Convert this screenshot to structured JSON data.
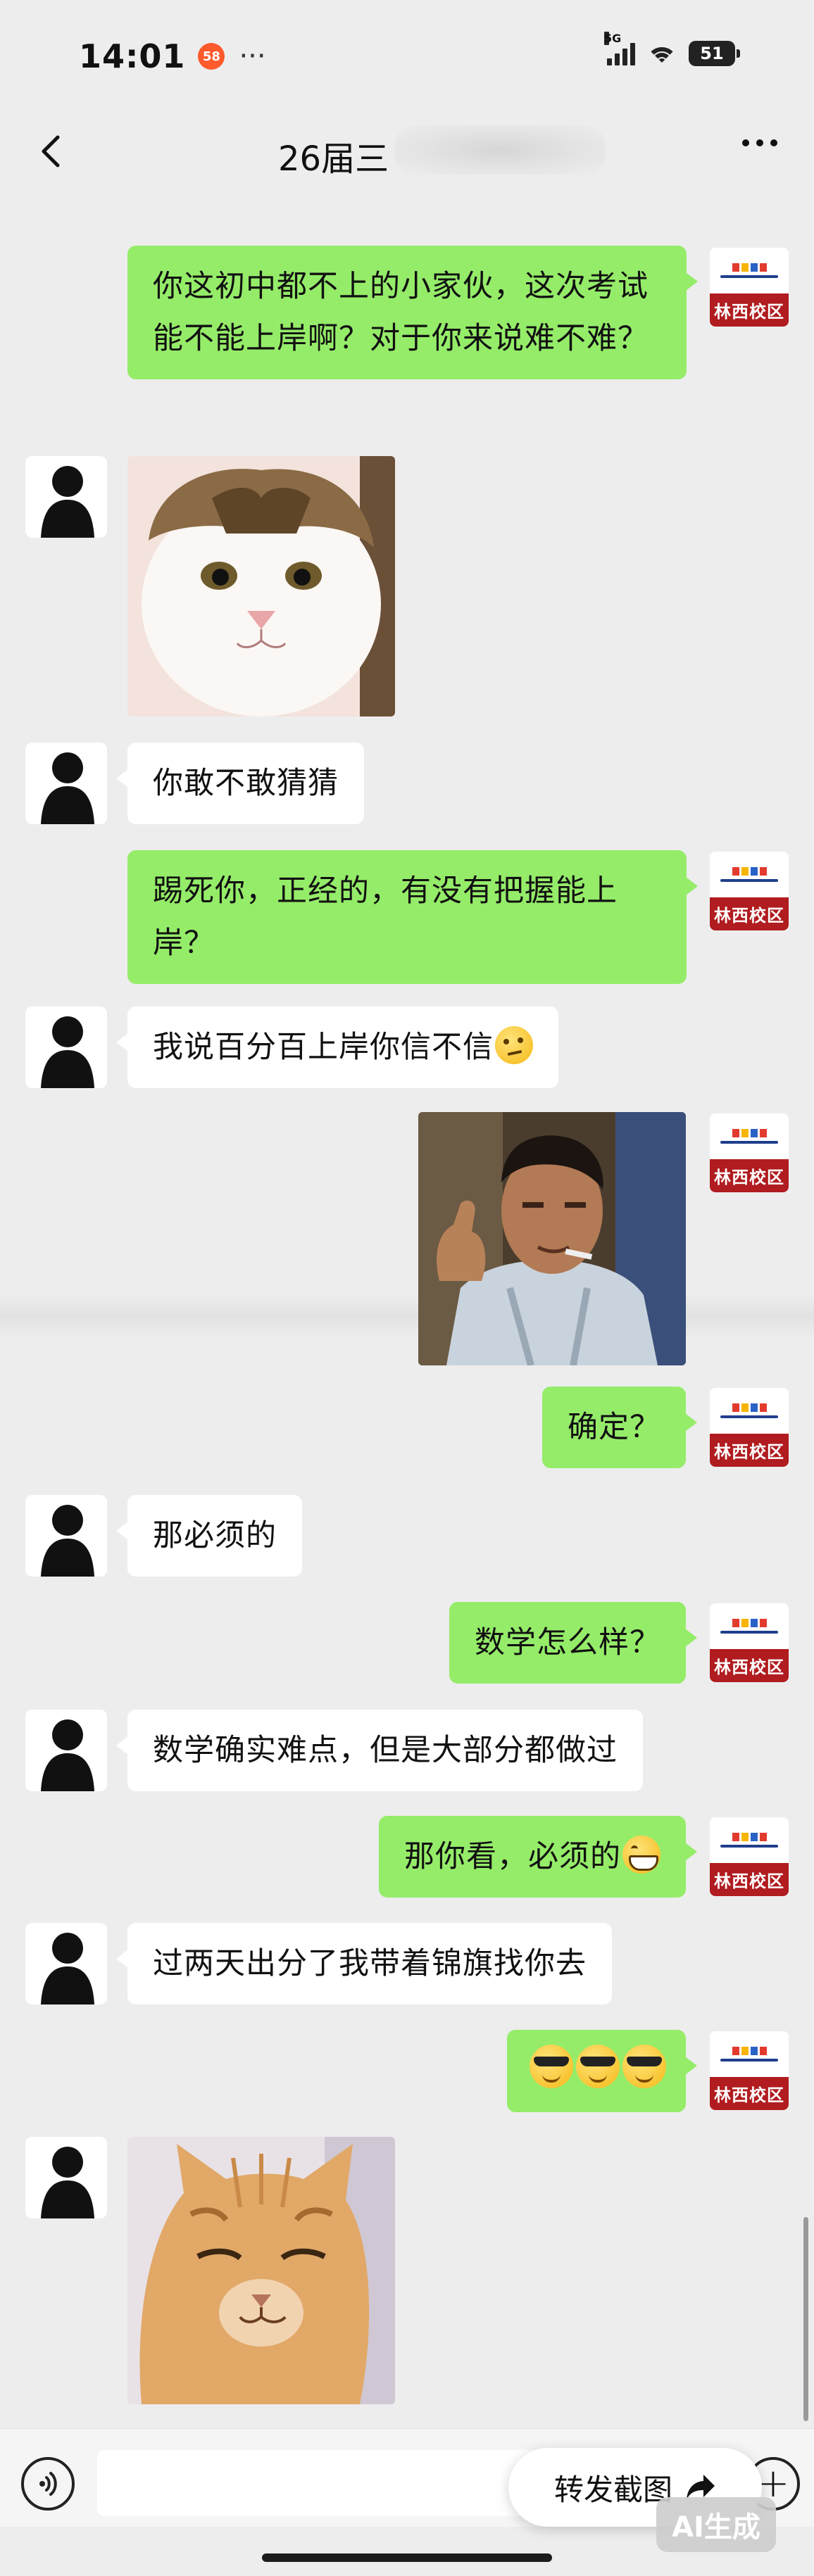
{
  "status_bar": {
    "time": "14:01",
    "badge": "58",
    "network": "5G",
    "battery": "51"
  },
  "header": {
    "title": "26届三"
  },
  "messages": [
    {
      "from": "self",
      "type": "text",
      "text": "你这初中都不上的小家伙，这次考试能不能上岸啊？对于你来说难不难？"
    },
    {
      "from": "other",
      "type": "sticker",
      "sticker": "grumpy-cat-sticker"
    },
    {
      "from": "other",
      "type": "text",
      "text": "你敢不敢猜猜"
    },
    {
      "from": "self",
      "type": "text",
      "text": "踢死你，正经的，有没有把握能上岸？"
    },
    {
      "from": "other",
      "type": "text",
      "text": "我说百分百上岸你信不信",
      "emoji": "smirk-emoji"
    },
    {
      "from": "self",
      "type": "sticker",
      "sticker": "man-thumbs-up-sticker"
    },
    {
      "from": "self",
      "type": "text",
      "text": "确定？"
    },
    {
      "from": "other",
      "type": "text",
      "text": "那必须的"
    },
    {
      "from": "self",
      "type": "text",
      "text": "数学怎么样？"
    },
    {
      "from": "other",
      "type": "text",
      "text": "数学确实难点，但是大部分都做过"
    },
    {
      "from": "self",
      "type": "text",
      "text": "那你看，必须的",
      "emoji": "grin-emoji"
    },
    {
      "from": "other",
      "type": "text",
      "text": "过两天出分了我带着锦旗找你去"
    },
    {
      "from": "self",
      "type": "emoji-only",
      "emojis": [
        "cool-emoji",
        "cool-emoji",
        "cool-emoji"
      ]
    },
    {
      "from": "other",
      "type": "sticker",
      "sticker": "smug-orange-cat-sticker"
    }
  ],
  "self_avatar": {
    "label": "林西校区"
  },
  "actions": {
    "forward_screenshot": "转发截图",
    "ai_badge": "AI生成"
  },
  "colors": {
    "self_bubble": "#95ec69",
    "other_bubble": "#ffffff",
    "background": "#ededed",
    "avatar_label": "#b01c1f"
  }
}
